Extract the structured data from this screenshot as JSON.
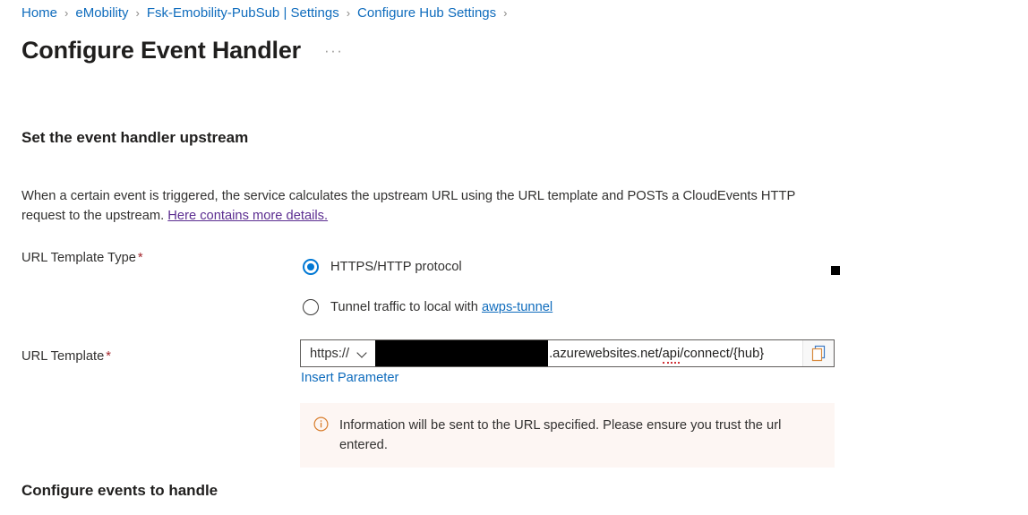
{
  "breadcrumb": {
    "separator": "›",
    "items": [
      {
        "label": "Home"
      },
      {
        "label": "eMobility"
      },
      {
        "label": "Fsk-Emobility-PubSub | Settings"
      },
      {
        "label": "Configure Hub Settings"
      }
    ]
  },
  "header": {
    "title": "Configure Event Handler",
    "more_menu": "···"
  },
  "sections": {
    "upstream_heading": "Set the event handler upstream",
    "events_heading": "Configure events to handle"
  },
  "description": {
    "text": "When a certain event is triggered, the service calculates the upstream URL using the URL template and POSTs a CloudEvents HTTP request to the upstream. ",
    "link_text": "Here contains more details."
  },
  "url_template_type": {
    "label": "URL Template Type",
    "required_mark": "*",
    "options": [
      {
        "label": "HTTPS/HTTP protocol",
        "selected": true
      },
      {
        "label": "Tunnel traffic to local with ",
        "link_text": "awps-tunnel",
        "selected": false
      }
    ]
  },
  "url_template": {
    "label": "URL Template",
    "required_mark": "*",
    "scheme_value": "https://",
    "redacted_host": "",
    "url_suffix_before_spell": ".azurewebsites.net/",
    "url_suffix_spell": "api",
    "url_suffix_after_spell": "/connect/{hub}",
    "copy_icon": "copy-icon",
    "insert_parameter_link": "Insert Parameter"
  },
  "info_banner": {
    "icon": "info-circle-icon",
    "text": "Information will be sent to the URL specified. Please ensure you trust the url entered."
  },
  "colors": {
    "link_blue": "#0f6cbd",
    "visited_purple": "#5c2e91",
    "accent_blue": "#0078d4",
    "required_red": "#a4262c",
    "info_orange": "#d87c2a",
    "info_bg": "#fdf6f3"
  }
}
